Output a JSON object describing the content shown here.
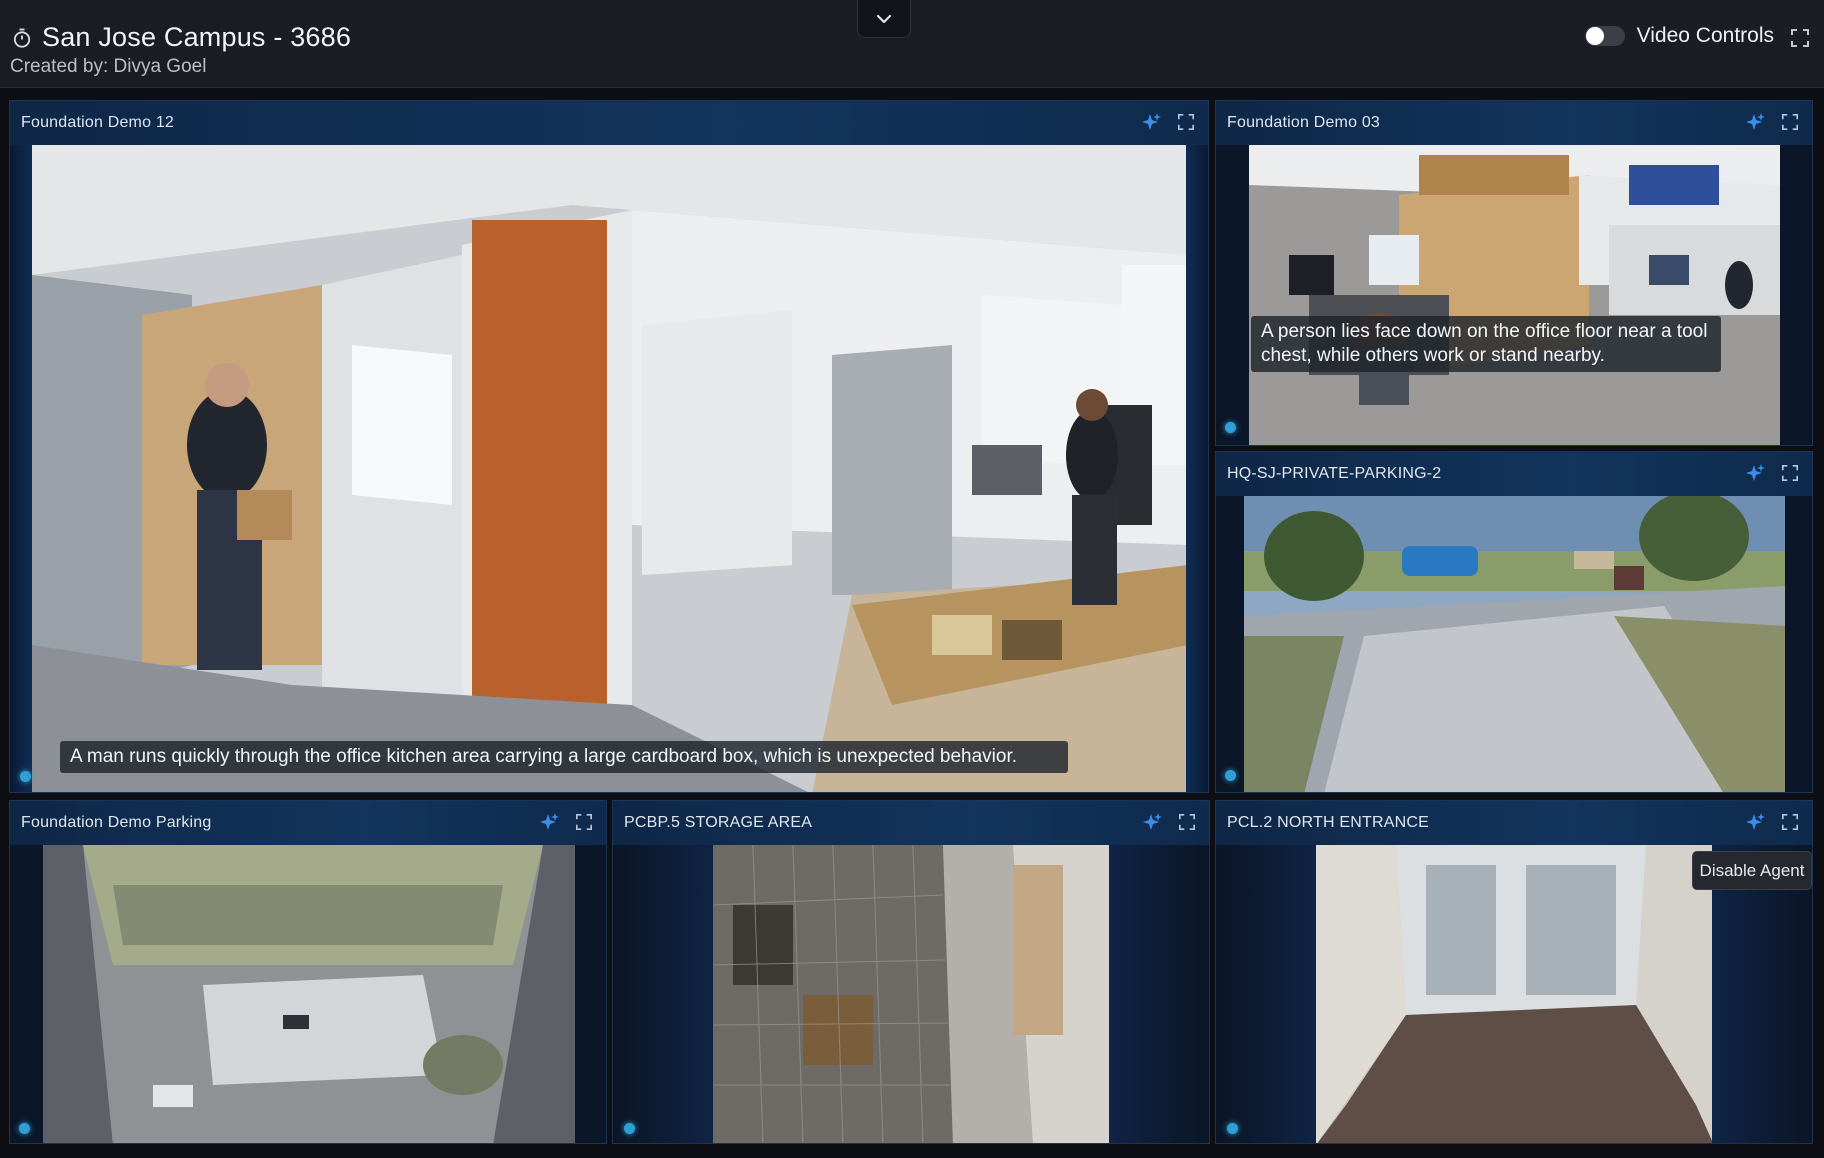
{
  "header": {
    "title": "San Jose Campus - 3686",
    "created_by": "Created by: Divya Goel",
    "video_controls_label": "Video Controls",
    "video_controls_on": false,
    "icons": {
      "timer": "stopwatch-icon",
      "collapse": "chevron-down-icon",
      "fullscreen": "fullscreen-icon"
    }
  },
  "panels": [
    {
      "name": "Foundation Demo 12",
      "caption": "A man runs quickly through the office kitchen area carrying a large cardboard box, which is unexpected behavior."
    },
    {
      "name": "Foundation Demo 03",
      "caption": "A person lies face down on the office floor near a tool chest, while others work or stand nearby."
    },
    {
      "name": "HQ-SJ-PRIVATE-PARKING-2",
      "caption": ""
    },
    {
      "name": "Foundation Demo Parking",
      "caption": ""
    },
    {
      "name": "PCBP.5 STORAGE AREA",
      "caption": ""
    },
    {
      "name": "PCL.2 NORTH ENTRANCE",
      "caption": ""
    }
  ],
  "tooltip": {
    "text": "Disable Agent"
  },
  "colors": {
    "accent": "#2f9fd6",
    "panel_bar": "#12345d",
    "background": "#0d0f14"
  }
}
